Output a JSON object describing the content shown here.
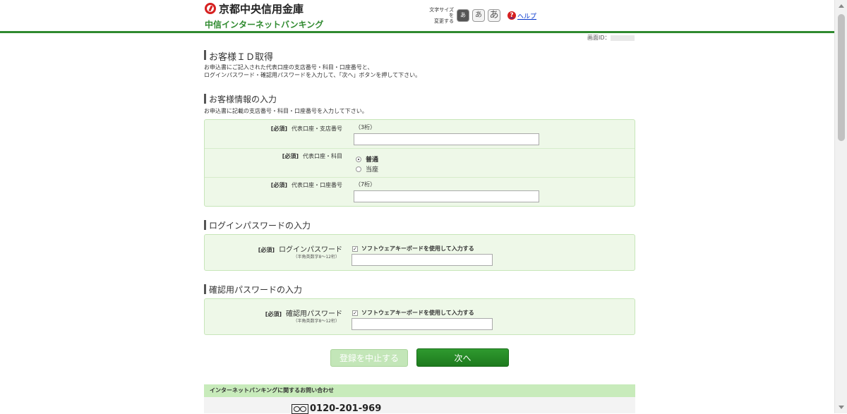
{
  "header": {
    "bank_name": "京都中央信用金庫",
    "service_name": "中信インターネットバンキング",
    "font_size_label_line1": "文字サイズを",
    "font_size_label_line2": "変更する",
    "font_small": "あ",
    "font_medium": "あ",
    "font_large": "あ",
    "help_label": "ヘルプ"
  },
  "screen_id_label": "画面ID：",
  "page": {
    "title": "お客様ＩＤ取得",
    "desc_line1": "お申込書にご記入された代表口座の支店番号・科目・口座番号と、",
    "desc_line2": "ログインパスワード・確認用パスワードを入力して、「次へ」ボタンを押して下さい。"
  },
  "customer_info": {
    "heading": "お客様情報の入力",
    "desc": "お申込書に記載の支店番号・科目・口座番号を入力して下さい。",
    "required_tag": "[必須]",
    "branch_label": "代表口座・支店番号",
    "branch_hint": "（3桁）",
    "branch_value": "",
    "account_type_label": "代表口座・科目",
    "account_type_options": [
      "普通",
      "当座"
    ],
    "account_type_selected": "普通",
    "account_number_label": "代表口座・口座番号",
    "account_number_hint": "（7桁）",
    "account_number_value": ""
  },
  "login_password": {
    "heading": "ログインパスワードの入力",
    "required_tag": "[必須]",
    "label": "ログインパスワード",
    "sub_label": "（半角英数字8～12桁）",
    "keyboard_checkbox_label": "ソフトウェアキーボードを使用して入力する",
    "keyboard_checked": true
  },
  "confirm_password": {
    "heading": "確認用パスワードの入力",
    "required_tag": "[必須]",
    "label": "確認用パスワード",
    "sub_label": "（半角英数字8～12桁）",
    "keyboard_checkbox_label": "ソフトウェアキーボードを使用して入力する",
    "keyboard_checked": true
  },
  "buttons": {
    "cancel": "登録を中止する",
    "next": "次へ"
  },
  "contact": {
    "heading": "インターネットバンキングに関するお問い合わせ",
    "phone": "0120-201-969"
  }
}
